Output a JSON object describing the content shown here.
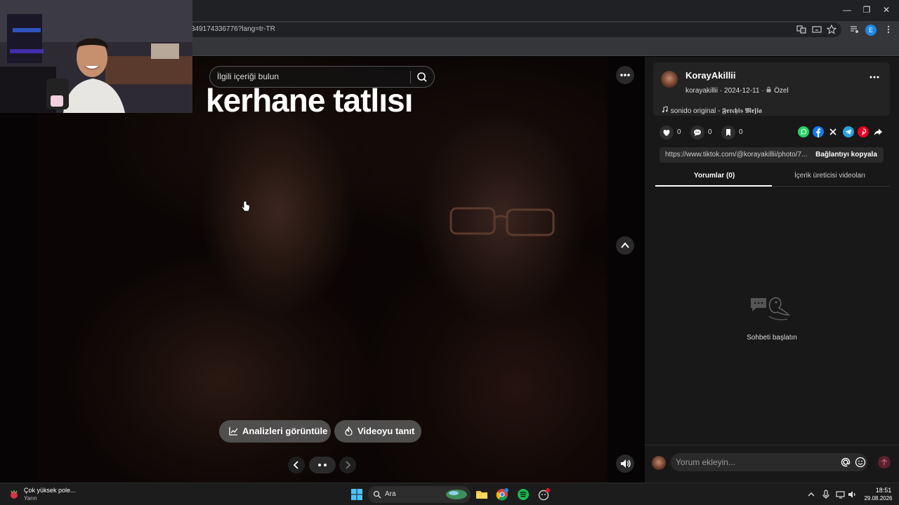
{
  "browser": {
    "url": "349174336776?lang=tr-TR",
    "window_controls": {
      "minimize": "—",
      "restore": "❐",
      "close": "✕"
    },
    "profile_letter": "E"
  },
  "post": {
    "overlay_text": "kerhane tatlısı",
    "search_placeholder": "İlgili içeriği bulun",
    "analytics_label": "Analizleri görüntüle",
    "promote_label": "Videoyu tanıt"
  },
  "author": {
    "name": "KorayAkillii",
    "handle": "korayakillii",
    "date": "2024-12-11",
    "separator": "·",
    "privacy": "Özel",
    "music": "sonido original - 𝕱𝖊𝖗𝖈𝖍𝖎𝖘 𝕸𝖊𝖏𝖎𝖆"
  },
  "stats": {
    "likes": "0",
    "comments": "0",
    "saves": "0"
  },
  "share": {
    "link": "https://www.tiktok.com/@korayakillii/photo/7...",
    "copy_label": "Bağlantıyı kopyala",
    "icons": [
      {
        "name": "whatsapp-icon",
        "color": "#25d366"
      },
      {
        "name": "facebook-icon",
        "color": "#1877f2"
      },
      {
        "name": "x-icon",
        "color": "#181818"
      },
      {
        "name": "telegram-icon",
        "color": "#2aa1da"
      },
      {
        "name": "pinterest-icon",
        "color": "#e60023"
      },
      {
        "name": "forward-icon",
        "color": "#181818"
      }
    ]
  },
  "tabs": {
    "comments": "Yorumlar (0)",
    "creator_videos": "İçerik üreticisi videoları"
  },
  "comments": {
    "empty_label": "Sohbeti başlatın",
    "input_placeholder": "Yorum ekleyin..."
  },
  "taskbar": {
    "weather_title": "Çok yüksek pole...",
    "weather_sub": "Yarın",
    "search_label": "Ara",
    "time": "18:51",
    "date": "29.08.2026"
  },
  "colors": {
    "accent_send": "#5a1f2b",
    "panel_bg": "#181818",
    "card_bg": "#232323"
  }
}
